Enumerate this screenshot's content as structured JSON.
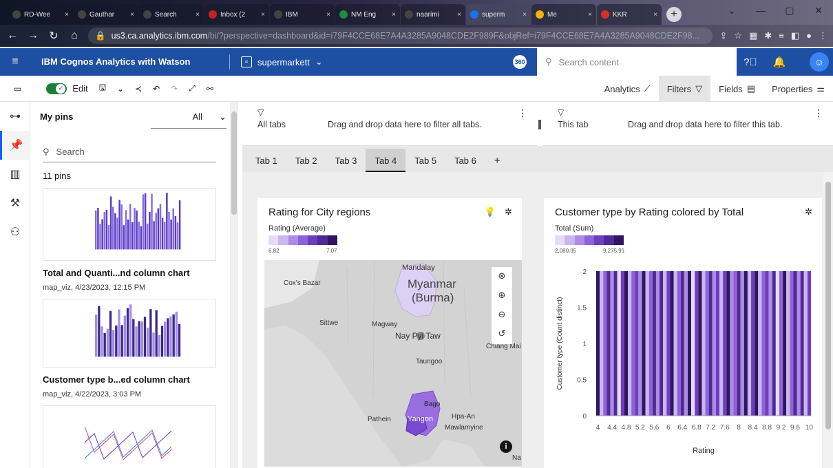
{
  "browser": {
    "tabs": [
      {
        "title": "RD-Wee",
        "color": "#444"
      },
      {
        "title": "Gauthar",
        "color": "#444"
      },
      {
        "title": "Search",
        "color": "#444"
      },
      {
        "title": "Inbox (2",
        "color": "#c5221f"
      },
      {
        "title": "IBM",
        "color": "#444"
      },
      {
        "title": "NM Eng",
        "color": "#1e8e3e"
      },
      {
        "title": "naarimi",
        "color": "#444"
      },
      {
        "title": "superm",
        "color": "#1a73e8"
      },
      {
        "title": "Me",
        "color": "#f4b400"
      },
      {
        "title": "KKR",
        "color": "#d93025"
      }
    ],
    "url_host": "us3.ca.analytics.ibm.com",
    "url_rest": "/bi/?perspective=dashboard&id=i79F4CCE68E7A4A3285A9048CDE2F989F&objRef=i79F4CCE68E7A4A3285A9048CDE2F98..."
  },
  "app": {
    "name": "IBM Cognos Analytics with Watson",
    "dashboard_name": "supermarkett",
    "badge": "360",
    "search_placeholder": "Search content"
  },
  "toolbar": {
    "edit_label": "Edit",
    "analytics": "Analytics",
    "filters": "Filters",
    "fields": "Fields",
    "properties": "Properties"
  },
  "pins": {
    "title": "My pins",
    "filter_value": "All",
    "search_placeholder": "Search",
    "count": "11 pins",
    "items": [
      {
        "title": "Total and Quanti...nd column chart",
        "meta": "map_viz, 4/23/2023, 12:15 PM"
      },
      {
        "title": "Customer type b...ed column chart",
        "meta": "map_viz, 4/22/2023, 3:03 PM"
      }
    ]
  },
  "filters": {
    "all_tabs_label": "All tabs",
    "all_tabs_hint": "Drag and drop data here to filter all tabs.",
    "this_tab_label": "This tab",
    "this_tab_hint": "Drag and drop data here to filter this tab."
  },
  "page_tabs": [
    "Tab 1",
    "Tab 2",
    "Tab 3",
    "Tab 4",
    "Tab 5",
    "Tab 6"
  ],
  "active_tab": "Tab 4",
  "map_card": {
    "title": "Rating for City regions",
    "legend_title": "Rating (Average)",
    "legend_min": "6.82",
    "legend_max": "7.07",
    "legend_colors": [
      "#e6dcf7",
      "#cbb6f0",
      "#ad8ce6",
      "#8e62d9",
      "#6d3fc0",
      "#4f2a96",
      "#2f1660"
    ],
    "labels": {
      "mandalay": "Mandalay",
      "coxs_bazar": "Cox's Bazar",
      "myanmar": "Myanmar",
      "burma": "(Burma)",
      "sittwe": "Sittwe",
      "magway": "Magway",
      "naypyitaw": "Nay Pyi Taw",
      "taungoo": "Taungoo",
      "chiang_mai": "Chiang Mai",
      "bago": "Bago",
      "pathein": "Pathein",
      "yangon": "Yangon",
      "hpa_an": "Hpa-An",
      "mawlamyine": "Mawlamyine",
      "na": "Na",
      "ng": "ng",
      "chi": "chi"
    }
  },
  "chart_card": {
    "title": "Customer type by Rating colored by Total",
    "legend_title": "Total (Sum)",
    "legend_min": "2,080.35",
    "legend_max": "9,275.91",
    "legend_colors": [
      "#e6dcf7",
      "#cbb6f0",
      "#ad8ce6",
      "#8e62d9",
      "#6d3fc0",
      "#4f2a96",
      "#2f1660"
    ]
  },
  "chart_data": {
    "type": "bar",
    "title": "Customer type by Rating colored by Total",
    "xlabel": "Rating",
    "ylabel": "Customer type (Count distinct)",
    "x_ticks": [
      "4",
      "4.4",
      "4.8",
      "5.2",
      "5.6",
      "6",
      "6.4",
      "6.8",
      "7.2",
      "7.6",
      "8",
      "8.4",
      "8.8",
      "9.2",
      "9.6",
      "10"
    ],
    "y_ticks": [
      "0",
      "0.5",
      "1",
      "1.5",
      "2"
    ],
    "ylim": [
      0,
      2
    ],
    "xlim": [
      4,
      10
    ],
    "color_legend": {
      "title": "Total (Sum)",
      "min": 2080.35,
      "max": 9275.91
    },
    "categories": [
      "4",
      "4.1",
      "4.2",
      "4.3",
      "4.4",
      "4.5",
      "4.6",
      "4.7",
      "4.8",
      "4.9",
      "5",
      "5.1",
      "5.2",
      "5.3",
      "5.4",
      "5.5",
      "5.6",
      "5.7",
      "5.8",
      "5.9",
      "6",
      "6.1",
      "6.2",
      "6.3",
      "6.4",
      "6.5",
      "6.6",
      "6.7",
      "6.8",
      "6.9",
      "7",
      "7.1",
      "7.2",
      "7.3",
      "7.4",
      "7.5",
      "7.6",
      "7.7",
      "7.8",
      "7.9",
      "8",
      "8.1",
      "8.2",
      "8.3",
      "8.4",
      "8.5",
      "8.6",
      "8.7",
      "8.8",
      "8.9",
      "9",
      "9.1",
      "9.2",
      "9.3",
      "9.4",
      "9.5",
      "9.6",
      "9.7",
      "9.8",
      "9.9",
      "10"
    ],
    "values": [
      2,
      2,
      2,
      2,
      2,
      2,
      2,
      2,
      2,
      2,
      2,
      2,
      2,
      2,
      2,
      2,
      2,
      2,
      2,
      2,
      2,
      2,
      2,
      2,
      2,
      2,
      2,
      2,
      2,
      2,
      2,
      2,
      2,
      2,
      2,
      2,
      2,
      2,
      2,
      2,
      2,
      2,
      2,
      2,
      2,
      2,
      2,
      2,
      2,
      2,
      2,
      2,
      2,
      2,
      2,
      2,
      2,
      2,
      2,
      2,
      2
    ],
    "color_values": [
      9000,
      3200,
      5400,
      7800,
      4100,
      8600,
      2600,
      6900,
      9200,
      3800,
      5200,
      7400,
      4800,
      8900,
      3000,
      6100,
      7700,
      4400,
      8300,
      2900,
      6600,
      9100,
      3600,
      5800,
      7900,
      4300,
      8700,
      2200,
      6400,
      9000,
      3400,
      5600,
      8100,
      4700,
      7300,
      2700,
      6800,
      9250,
      3900,
      5100,
      7600,
      4200,
      8800,
      3100,
      6300,
      9150,
      3500,
      5900,
      7100,
      4600,
      8500,
      2400,
      6200,
      8950,
      3700,
      5300,
      7500,
      4900,
      8400,
      3300,
      6700
    ]
  }
}
